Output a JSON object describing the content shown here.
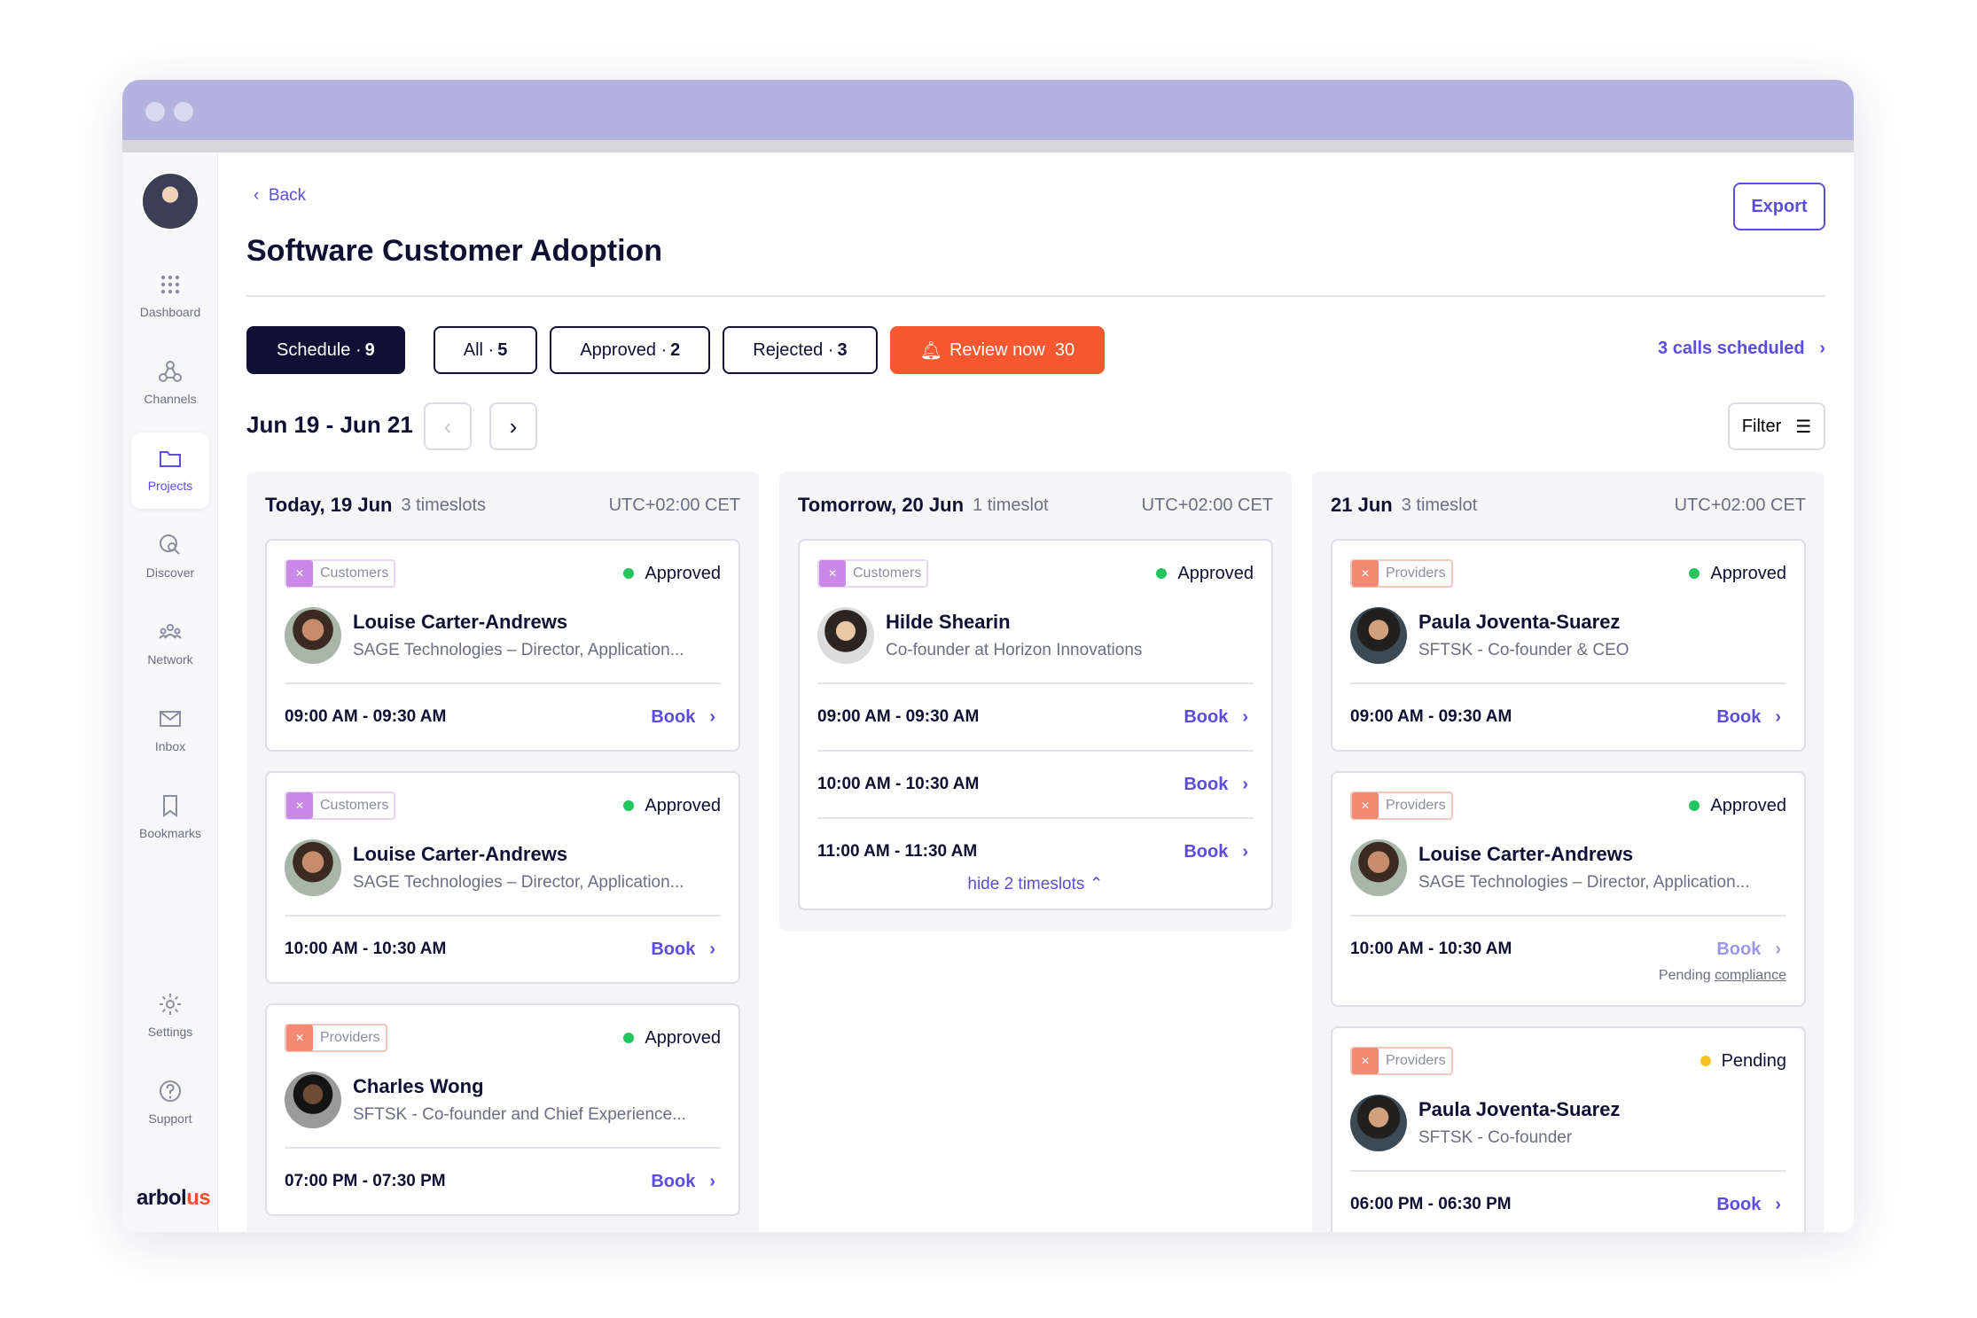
{
  "sidebar": {
    "items": [
      {
        "label": "Dashboard",
        "icon": "grid-icon"
      },
      {
        "label": "Channels",
        "icon": "channels-icon"
      },
      {
        "label": "Projects",
        "icon": "folder-icon"
      },
      {
        "label": "Discover",
        "icon": "globe-search-icon"
      },
      {
        "label": "Network",
        "icon": "network-icon"
      },
      {
        "label": "Inbox",
        "icon": "mail-icon"
      },
      {
        "label": "Bookmarks",
        "icon": "bookmark-icon"
      },
      {
        "label": "Settings",
        "icon": "gear-icon"
      },
      {
        "label": "Support",
        "icon": "help-icon"
      }
    ],
    "active": "Projects",
    "logo_main": "arbol",
    "logo_accent": "us"
  },
  "header": {
    "back_label": "Back",
    "title": "Software Customer Adoption",
    "export_label": "Export"
  },
  "tabs": {
    "schedule": {
      "label": "Schedule ·",
      "count": "9"
    },
    "all": {
      "label": "All ·",
      "count": "5"
    },
    "approved": {
      "label": "Approved ·",
      "count": "2"
    },
    "rejected": {
      "label": "Rejected ·",
      "count": "3"
    },
    "review": {
      "label": "Review now",
      "count": "30"
    }
  },
  "calls_link": "3 calls scheduled",
  "date_range": "Jun 19 - Jun 21",
  "filter_label": "Filter",
  "columns": [
    {
      "day": "Today, 19 Jun",
      "count": "3 timeslots",
      "tz": "UTC+02:00 CET",
      "cards": [
        {
          "chip": "Customers",
          "status": "Approved",
          "name": "Louise Carter-Andrews",
          "role": "SAGE Technologies – Director, Application...",
          "slots": [
            "09:00 AM - 09:30 AM"
          ],
          "book": "Book"
        },
        {
          "chip": "Customers",
          "status": "Approved",
          "name": "Louise Carter-Andrews",
          "role": "SAGE Technologies – Director, Application...",
          "slots": [
            "10:00 AM - 10:30 AM"
          ],
          "book": "Book"
        },
        {
          "chip": "Providers",
          "status": "Approved",
          "name": "Charles Wong",
          "role": "SFTSK - Co-founder and Chief Experience...",
          "slots": [
            "07:00 PM - 07:30 PM"
          ],
          "book": "Book"
        }
      ]
    },
    {
      "day": "Tomorrow, 20 Jun",
      "count": "1 timeslot",
      "tz": "UTC+02:00 CET",
      "cards": [
        {
          "chip": "Customers",
          "status": "Approved",
          "name": "Hilde Shearin",
          "role": "Co-founder at Horizon Innovations",
          "slots": [
            "09:00 AM - 09:30 AM",
            "10:00 AM - 10:30 AM",
            "11:00 AM - 11:30 AM"
          ],
          "book": "Book",
          "hide_label": "hide 2 timeslots ⌃"
        }
      ]
    },
    {
      "day": "21 Jun",
      "count": "3 timeslot",
      "tz": "UTC+02:00 CET",
      "cards": [
        {
          "chip": "Providers",
          "status": "Approved",
          "name": "Paula Joventa-Suarez",
          "role": "SFTSK - Co-founder & CEO",
          "slots": [
            "09:00 AM - 09:30 AM"
          ],
          "book": "Book"
        },
        {
          "chip": "Providers",
          "status": "Approved",
          "name": "Louise Carter-Andrews",
          "role": "SAGE Technologies – Director, Application...",
          "slots": [
            "10:00 AM - 10:30 AM"
          ],
          "book": "Book",
          "note_prefix": "Pending",
          "note_link": "compliance"
        },
        {
          "chip": "Providers",
          "status": "Pending",
          "name": "Paula Joventa-Suarez",
          "role": "SFTSK - Co-founder",
          "slots": [
            "06:00 PM - 06:30 PM"
          ],
          "book": "Book"
        }
      ]
    }
  ],
  "colors": {
    "accent": "#5a4de0",
    "dark": "#0f1033",
    "review": "#f7582f",
    "approved": "#22c55e",
    "pending": "#f4c21a",
    "titlebar": "#b4b2de"
  }
}
